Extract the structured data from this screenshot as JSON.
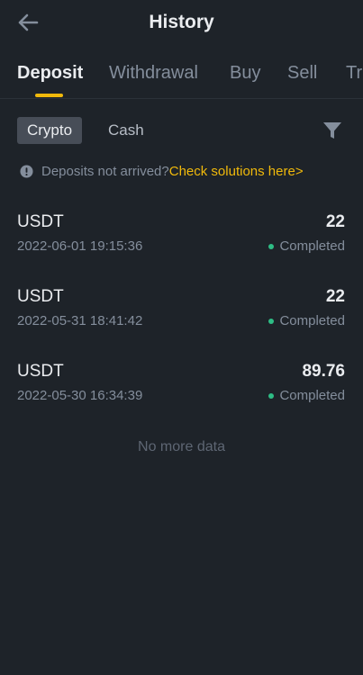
{
  "header": {
    "title": "History",
    "back_icon": "arrow-left-icon"
  },
  "tabs": [
    {
      "label": "Deposit",
      "active": true
    },
    {
      "label": "Withdrawal",
      "active": false
    },
    {
      "label": "Buy",
      "active": false
    },
    {
      "label": "Sell",
      "active": false
    },
    {
      "label": "Tra",
      "active": false
    }
  ],
  "subtabs": [
    {
      "label": "Crypto",
      "active": true
    },
    {
      "label": "Cash",
      "active": false
    }
  ],
  "filter_icon": "filter-icon",
  "notice": {
    "icon": "info-icon",
    "text": "Deposits not arrived?",
    "link": "Check solutions here>"
  },
  "records": [
    {
      "coin": "USDT",
      "amount": "22",
      "time": "2022-06-01 19:15:36",
      "status": "Completed"
    },
    {
      "coin": "USDT",
      "amount": "22",
      "time": "2022-05-31 18:41:42",
      "status": "Completed"
    },
    {
      "coin": "USDT",
      "amount": "89.76",
      "time": "2022-05-30 16:34:39",
      "status": "Completed"
    }
  ],
  "footer": {
    "no_more": "No more data"
  },
  "colors": {
    "background": "#1e2329",
    "accent": "#f0b90b",
    "status_completed": "#2ebd85",
    "text_primary": "#eaecef",
    "text_secondary": "#848e9c"
  }
}
